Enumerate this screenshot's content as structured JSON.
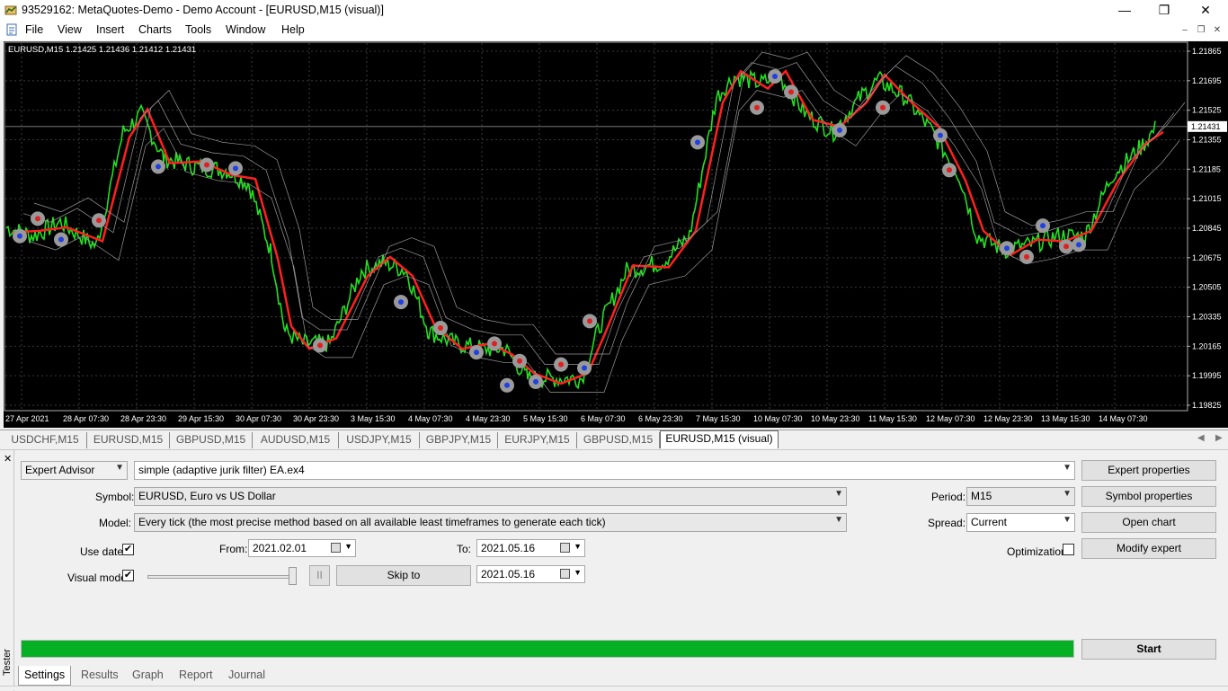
{
  "window": {
    "title": "93529162: MetaQuotes-Demo - Demo Account - [EURUSD,M15 (visual)]",
    "minimize_glyph": "—",
    "maximize_glyph": "❐",
    "close_glyph": "✕"
  },
  "menu": [
    "File",
    "View",
    "Insert",
    "Charts",
    "Tools",
    "Window",
    "Help"
  ],
  "chart": {
    "symbol_info": "EURUSD,M15  1.21425 1.21436 1.21412 1.21431",
    "current_price": "1.21431",
    "price_labels": [
      "1.21865",
      "1.21695",
      "1.21525",
      "1.21355",
      "1.21185",
      "1.21015",
      "1.20845",
      "1.20675",
      "1.20505",
      "1.20335",
      "1.20165",
      "1.19995",
      "1.19825"
    ],
    "time_labels": [
      "27 Apr 2021",
      "28 Apr 07:30",
      "28 Apr 23:30",
      "29 Apr 15:30",
      "30 Apr 07:30",
      "30 Apr 23:30",
      "3 May 15:30",
      "4 May 07:30",
      "4 May 23:30",
      "5 May 15:30",
      "6 May 07:30",
      "6 May 23:30",
      "7 May 15:30",
      "10 May 07:30",
      "10 May 23:30",
      "11 May 15:30",
      "12 May 07:30",
      "12 May 23:30",
      "13 May 15:30",
      "14 May 07:30"
    ],
    "colors": {
      "background": "#000000",
      "price": "#22e022",
      "signal_line": "#ff2020",
      "grid": "#3a3a3a"
    }
  },
  "chart_tabs": [
    "USDCHF,M15",
    "EURUSD,M15",
    "GBPUSD,M15",
    "AUDUSD,M15",
    "USDJPY,M15",
    "GBPJPY,M15",
    "EURJPY,M15",
    "GBPUSD,M15",
    "EURUSD,M15 (visual)"
  ],
  "tester": {
    "side_label": "Tester",
    "type_select": "Expert Advisor",
    "expert_file": "simple (adaptive jurik filter) EA.ex4",
    "symbol_label": "Symbol:",
    "symbol_value": "EURUSD, Euro vs US Dollar",
    "model_label": "Model:",
    "model_value": "Every tick (the most precise method based on all available least timeframes to generate each tick)",
    "period_label": "Period:",
    "period_value": "M15",
    "spread_label": "Spread:",
    "spread_value": "Current",
    "use_date_label": "Use date",
    "from_label": "From:",
    "from_value": "2021.02.01",
    "to_label": "To:",
    "to_value": "2021.05.16",
    "visual_mode_label": "Visual mode",
    "skip_to_label": "Skip to",
    "skip_to_value": "2021.05.16",
    "optimization_label": "Optimization",
    "pause_glyph": "II",
    "buttons": {
      "expert_properties": "Expert properties",
      "symbol_properties": "Symbol properties",
      "open_chart": "Open chart",
      "modify_expert": "Modify expert",
      "start": "Start"
    },
    "use_date_checked": true,
    "visual_mode_checked": true,
    "progress": 1.0
  },
  "bottom_tabs": [
    "Settings",
    "Results",
    "Graph",
    "Report",
    "Journal"
  ]
}
